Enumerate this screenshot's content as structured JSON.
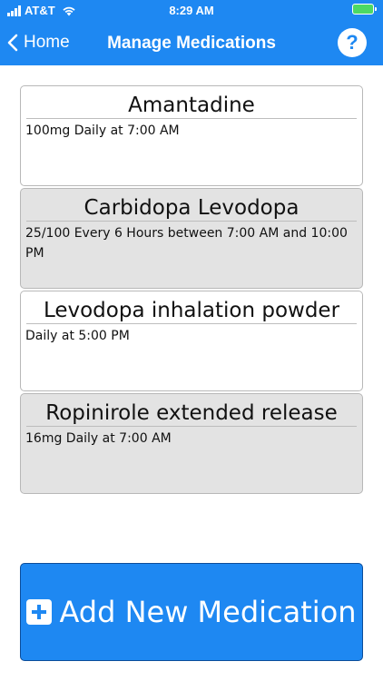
{
  "status_bar": {
    "carrier": "AT&T",
    "time": "8:29 AM"
  },
  "nav": {
    "back_label": "Home",
    "title": "Manage Medications",
    "help_label": "?"
  },
  "medications": [
    {
      "name": "Amantadine",
      "dose": "100mg Daily at 7:00 AM"
    },
    {
      "name": "Carbidopa Levodopa",
      "dose": "25/100 Every 6 Hours between 7:00 AM and 10:00 PM"
    },
    {
      "name": "Levodopa inhalation powder",
      "dose": "Daily at 5:00 PM"
    },
    {
      "name": "Ropinirole extended release",
      "dose": "16mg Daily at 7:00 AM"
    }
  ],
  "add_button": {
    "label": "Add New Medication"
  },
  "colors": {
    "accent": "#1e88f2",
    "card_alt": "#e3e3e3"
  }
}
